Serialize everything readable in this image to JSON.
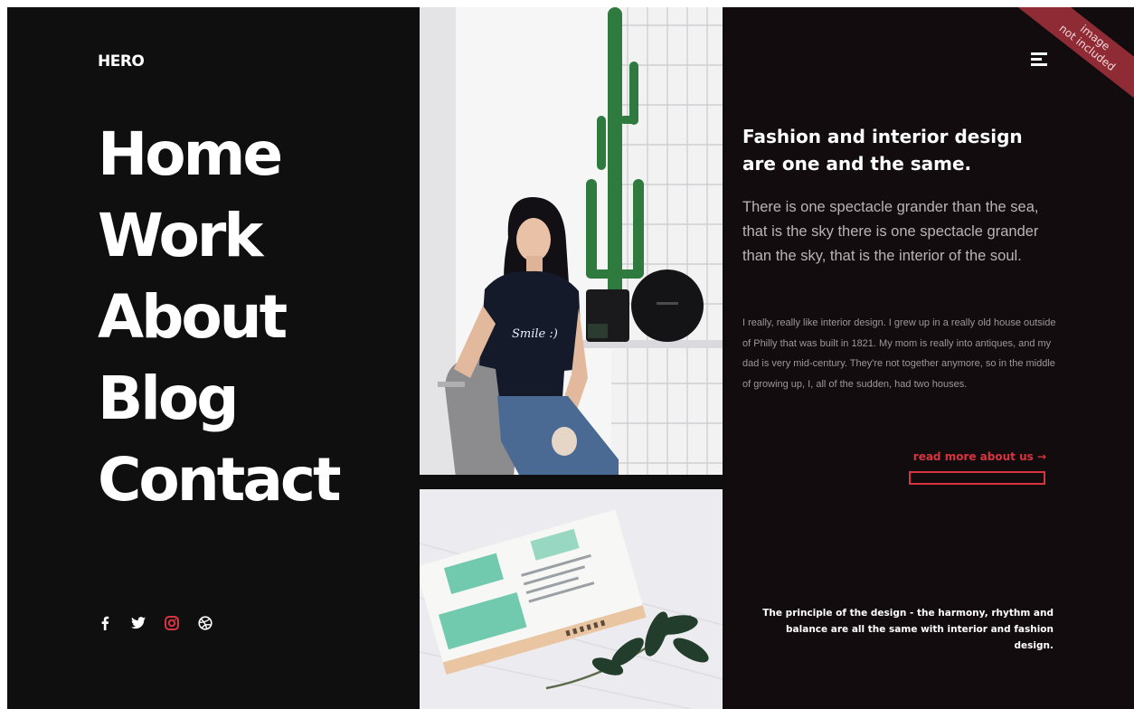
{
  "logo": "HERO",
  "nav": [
    "Home",
    "Work",
    "About",
    "Blog",
    "Contact"
  ],
  "social": [
    {
      "name": "facebook-icon",
      "glyph": "f",
      "color": "#ffffff"
    },
    {
      "name": "twitter-icon",
      "glyph": "twitter",
      "color": "#ffffff"
    },
    {
      "name": "instagram-icon",
      "glyph": "instagram",
      "color": "#d7343f"
    },
    {
      "name": "dribbble-icon",
      "glyph": "dribbble",
      "color": "#ffffff"
    }
  ],
  "ribbon": {
    "line1": "image",
    "line2": "not included"
  },
  "right": {
    "headline": "Fashion and interior design are one and the same.",
    "lead": "There is one spectacle grander than the sea, that is the sky there is one spectacle grander than the sky, that is the interior of the soul.",
    "body": "I really, really like interior design. I grew up in a really old house outside of Philly that was built in 1821. My mom is really into antiques, and my dad is very mid-century. They're not together anymore, so in the middle of growing up, I, all of the sudden, had two houses.",
    "read_more": "read more about us →",
    "quote": "The principle of the design - the harmony, rhythm and balance are all the same with interior and fashion design."
  },
  "photo_text": {
    "shirt": "Smile :)"
  },
  "colors": {
    "accent": "#d7343f",
    "background": "#0f0f10",
    "right_panel": "#120c0e"
  }
}
